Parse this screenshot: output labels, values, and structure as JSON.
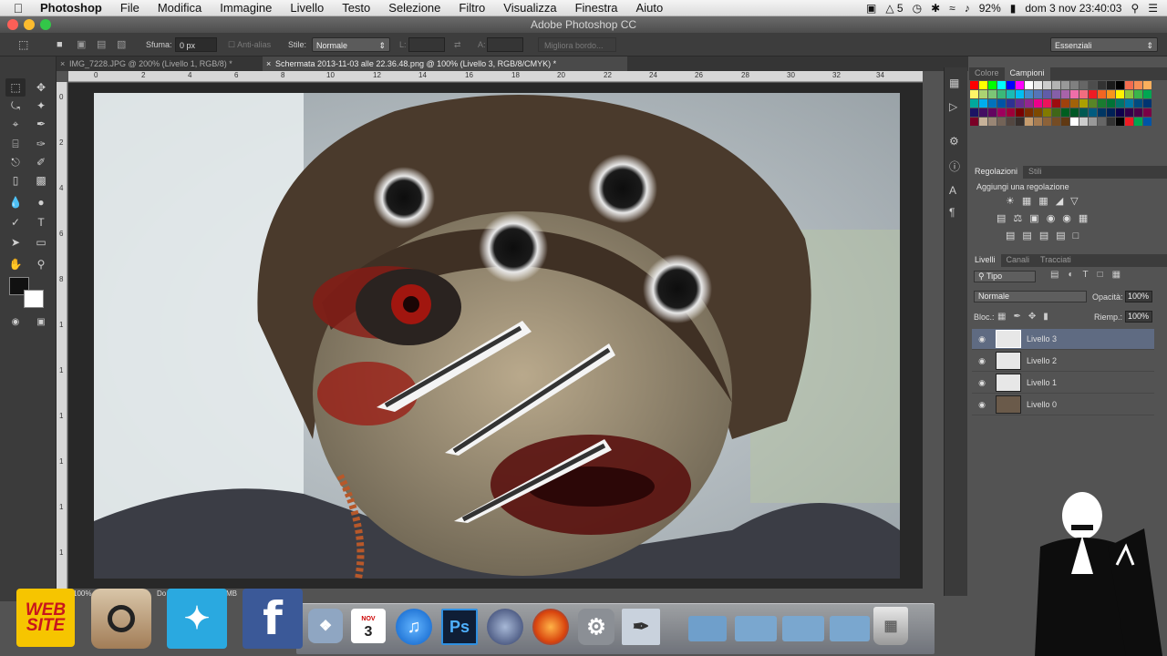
{
  "menubar": {
    "app": "Photoshop",
    "items": [
      "File",
      "Modifica",
      "Immagine",
      "Livello",
      "Testo",
      "Selezione",
      "Filtro",
      "Visualizza",
      "Finestra",
      "Aiuto"
    ],
    "status": {
      "adobe_badge": "5",
      "battery": "92%",
      "clock": "dom 3 nov  23:40:03"
    }
  },
  "window": {
    "title": "Adobe Photoshop CC"
  },
  "options": {
    "feather_label": "Sfuma:",
    "feather_value": "0 px",
    "antialias_label": "Anti-alias",
    "style_label": "Stile:",
    "style_value": "Normale",
    "width_label": "L:",
    "height_label": "A:",
    "refine_label": "Migliora bordo...",
    "workspace": "Essenziali"
  },
  "tabs": [
    {
      "label": "IMG_7228.JPG @ 200% (Livello 1, RGB/8) *"
    },
    {
      "label": "Schermata 2013-11-03 alle 22.36.48.png @ 100% (Livello 3, RGB/8/CMYK) *"
    }
  ],
  "rulers": {
    "h": [
      "0",
      "2",
      "4",
      "6",
      "8",
      "10",
      "12",
      "14",
      "16",
      "18",
      "20",
      "22",
      "24",
      "26",
      "28",
      "30",
      "32",
      "34"
    ],
    "v": [
      "0",
      "2",
      "4",
      "6",
      "8",
      "1",
      "1",
      "1",
      "1",
      "1",
      "1",
      "2"
    ]
  },
  "status": {
    "zoom": "100%",
    "doc": "Do",
    "size": "MB"
  },
  "panels": {
    "color_tabs": [
      "Colore",
      "Campioni"
    ],
    "swatches": [
      "#ff0000",
      "#ffff00",
      "#00ff00",
      "#00ffff",
      "#0000ff",
      "#ff00ff",
      "#ffffff",
      "#e6e6e6",
      "#cccccc",
      "#b3b3b3",
      "#999999",
      "#808080",
      "#666666",
      "#4d4d4d",
      "#333333",
      "#1a1a1a",
      "#000000",
      "#f26c4f",
      "#f68e55",
      "#fbaf5c",
      "#fff467",
      "#acd372",
      "#7cc576",
      "#3bb878",
      "#1abbb4",
      "#00bff3",
      "#438ccb",
      "#5574b9",
      "#605ca8",
      "#855fa8",
      "#a763a9",
      "#ef6ea8",
      "#f16d7e",
      "#ed1c24",
      "#f26522",
      "#f7941d",
      "#fff200",
      "#8dc63f",
      "#39b54a",
      "#00a651",
      "#00a99d",
      "#00aeef",
      "#0072bc",
      "#0054a6",
      "#2e3192",
      "#662d91",
      "#92278f",
      "#ec008c",
      "#ed145b",
      "#9e0b0f",
      "#a0410d",
      "#a36209",
      "#aba000",
      "#598527",
      "#1a7b30",
      "#007236",
      "#00746b",
      "#0076a3",
      "#004b80",
      "#003471",
      "#1b1464",
      "#440e62",
      "#630460",
      "#9e005d",
      "#9e0039",
      "#790000",
      "#7b2e00",
      "#7d4900",
      "#827b00",
      "#406618",
      "#005e20",
      "#005826",
      "#005952",
      "#005b7f",
      "#003663",
      "#002157",
      "#0d004c",
      "#32004b",
      "#4b0049",
      "#7b0046",
      "#7a0026",
      "#c7b299",
      "#998675",
      "#736357",
      "#534741",
      "#37302d",
      "#c69c6e",
      "#a67c52",
      "#8c6239",
      "#754c24",
      "#603913",
      "#ffffff",
      "#cccccc",
      "#999999",
      "#666666",
      "#333333",
      "#000000",
      "#ed1c24",
      "#00a651",
      "#0054a6"
    ],
    "adjust_tabs": [
      "Regolazioni",
      "Stili"
    ],
    "adjust_title": "Aggiungi una regolazione",
    "layers_tabs": [
      "Livelli",
      "Canali",
      "Tracciati"
    ],
    "filter_label": "Tipo",
    "blend_mode": "Normale",
    "opacity_label": "Opacità:",
    "opacity_value": "100%",
    "lock_label": "Bloc.:",
    "fill_label": "Riemp.:",
    "fill_value": "100%",
    "layers": [
      {
        "name": "Livello 3",
        "active": true
      },
      {
        "name": "Livello 2",
        "active": false
      },
      {
        "name": "Livello 1",
        "active": false
      },
      {
        "name": "Livello 0",
        "active": false
      }
    ]
  },
  "dock": {
    "website_label_1": "WEB",
    "website_label_2": "SITE",
    "calendar_month": "NOV",
    "calendar_day": "3",
    "ps_label": "Ps"
  }
}
